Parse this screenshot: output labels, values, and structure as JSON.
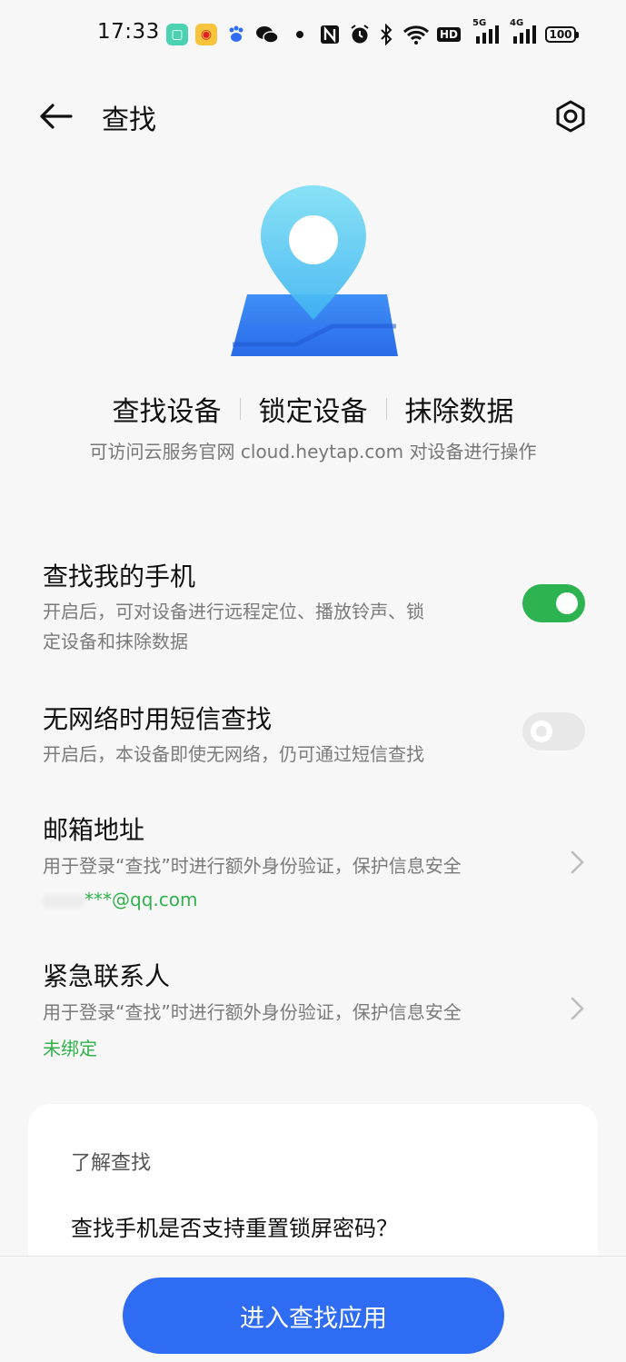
{
  "status_bar": {
    "time": "17:33",
    "network_1": "5G",
    "network_2": "4G",
    "hd_label": "HD",
    "battery": "100"
  },
  "header": {
    "title": "查找"
  },
  "actions": {
    "find_device": "查找设备",
    "lock_device": "锁定设备",
    "erase_data": "抹除数据"
  },
  "hint": "可访问云服务官网 cloud.heytap.com 对设备进行操作",
  "settings": {
    "find_my_phone": {
      "title": "查找我的手机",
      "desc_line1": "开启后，可对设备进行远程定位、播放铃声、锁",
      "desc_line2": "定设备和抹除数据",
      "enabled": true
    },
    "sms_find": {
      "title": "无网络时用短信查找",
      "desc": "开启后，本设备即使无网络，仍可通过短信查找",
      "enabled": false
    },
    "email": {
      "title": "邮箱地址",
      "desc": "用于登录“查找”时进行额外身份验证，保护信息安全",
      "value": "***@qq.com"
    },
    "emergency_contact": {
      "title": "紧急联系人",
      "desc": "用于登录“查找”时进行额外身份验证，保护信息安全",
      "value": "未绑定"
    }
  },
  "learn": {
    "title": "了解查找",
    "question": "查找手机是否支持重置锁屏密码？"
  },
  "bottom_button": "进入查找应用",
  "colors": {
    "accent_green": "#2db350",
    "primary_blue": "#2f6cf4",
    "background": "#f7f7f7"
  }
}
